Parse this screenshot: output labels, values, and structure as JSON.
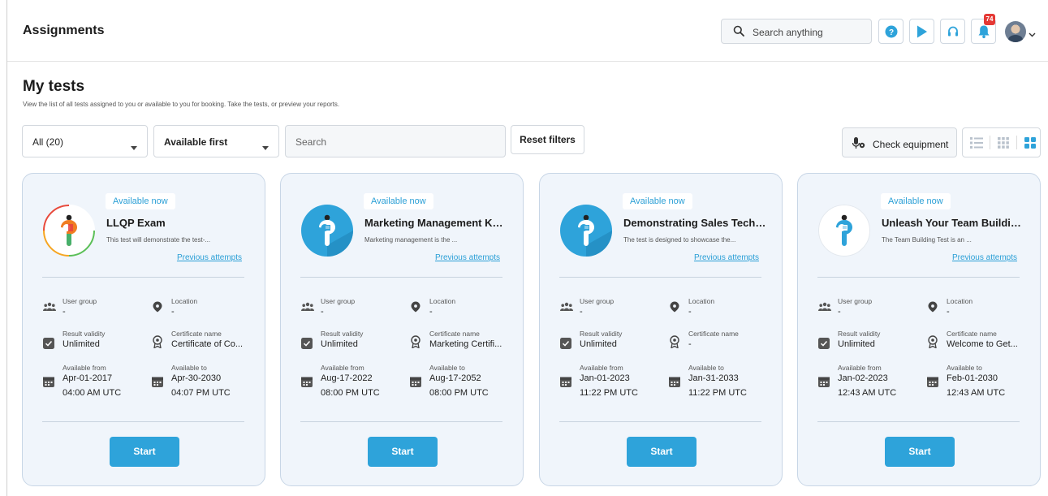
{
  "header": {
    "title": "Assignments",
    "search_placeholder": "Search anything",
    "notification_count": "74",
    "icons": [
      "help-icon",
      "play-icon",
      "headset-icon",
      "bell-icon",
      "avatar",
      "chevron-down-icon"
    ]
  },
  "page": {
    "title": "My tests",
    "subtitle": "View the list of all tests assigned to you or available to you for booking. Take the tests, or preview your reports."
  },
  "filters": {
    "status_value": "All (20)",
    "sort_value": "Available first",
    "search_placeholder": "Search",
    "reset_label": "Reset filters",
    "check_equipment_label": "Check equipment",
    "view_modes": [
      "list",
      "grid-small",
      "grid-large"
    ],
    "active_view": "grid-large"
  },
  "labels": {
    "user_group": "User group",
    "location": "Location",
    "result_validity": "Result validity",
    "certificate_name": "Certificate name",
    "available_from": "Available from",
    "available_to": "Available to",
    "start": "Start",
    "previous_attempts": "Previous attempts"
  },
  "colors": {
    "accent": "#2ea3da",
    "card_bg": "#f0f5fb",
    "badge": "#e53935"
  },
  "cards": [
    {
      "status": "Available now",
      "title": "LLQP Exam",
      "description": "This test will demonstrate the test-...",
      "previous_attempts": "Previous attempts",
      "user_group": "-",
      "location": "-",
      "result_validity": "Unlimited",
      "certificate_name": "Certificate of Co...",
      "available_from_date": "Apr-01-2017",
      "available_from_time": "04:00 AM UTC",
      "available_to_date": "Apr-30-2030",
      "available_to_time": "04:07 PM UTC",
      "start_label": "Start"
    },
    {
      "status": "Available now",
      "title": "Marketing Management Kno...",
      "description": "Marketing management is the ...",
      "previous_attempts": "Previous attempts",
      "user_group": "-",
      "location": "-",
      "result_validity": "Unlimited",
      "certificate_name": "Marketing Certifi...",
      "available_from_date": "Aug-17-2022",
      "available_from_time": "08:00 PM UTC",
      "available_to_date": "Aug-17-2052",
      "available_to_time": "08:00 PM UTC",
      "start_label": "Start"
    },
    {
      "status": "Available now",
      "title": "Demonstrating Sales Techni...",
      "description": "The test is designed to showcase the...",
      "previous_attempts": "Previous attempts",
      "user_group": "-",
      "location": "-",
      "result_validity": "Unlimited",
      "certificate_name": "-",
      "available_from_date": "Jan-01-2023",
      "available_from_time": "11:22 PM UTC",
      "available_to_date": "Jan-31-2033",
      "available_to_time": "11:22 PM UTC",
      "start_label": "Start"
    },
    {
      "status": "Available now",
      "title": "Unleash Your Team Building ...",
      "description": "The Team Building Test is an ...",
      "previous_attempts": "Previous attempts",
      "user_group": "-",
      "location": "-",
      "result_validity": "Unlimited",
      "certificate_name": "Welcome to Get...",
      "available_from_date": "Jan-02-2023",
      "available_from_time": "12:43 AM UTC",
      "available_to_date": "Feb-01-2030",
      "available_to_time": "12:43 AM UTC",
      "start_label": "Start"
    }
  ]
}
